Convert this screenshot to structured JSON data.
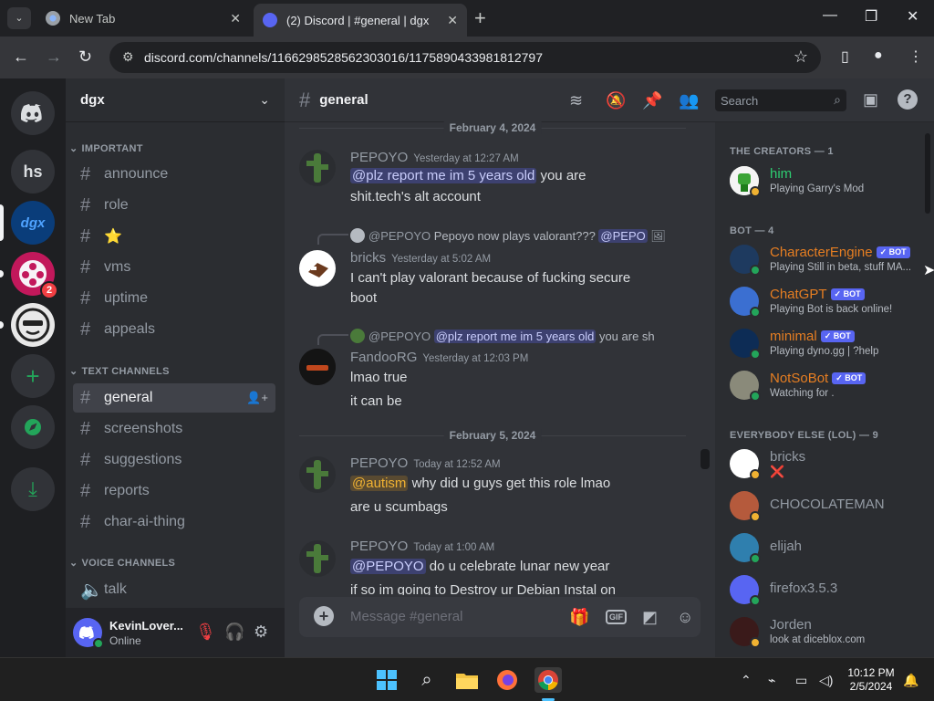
{
  "browser": {
    "tabs": [
      {
        "title": "New Tab"
      },
      {
        "title": "(2) Discord | #general | dgx"
      }
    ],
    "url": "discord.com/channels/1166298528562303016/1175890433981812797"
  },
  "servers": {
    "items": [
      {
        "name": "Home",
        "icon": "discord-logo-icon"
      },
      {
        "name": "hs",
        "label": "hs"
      },
      {
        "name": "dgx",
        "label": "dgx"
      },
      {
        "name": "film-server",
        "badge": "2"
      },
      {
        "name": "face-server"
      },
      {
        "name": "Add a Server",
        "icon": "plus-icon"
      },
      {
        "name": "Explore",
        "icon": "compass-icon"
      },
      {
        "name": "Download Apps",
        "icon": "download-icon"
      }
    ]
  },
  "guild": {
    "name": "dgx",
    "categories": [
      {
        "label": "IMPORTANT",
        "channels": [
          "announce",
          "role",
          "⭐",
          "vms",
          "uptime",
          "appeals"
        ]
      },
      {
        "label": "TEXT CHANNELS",
        "channels": [
          "general",
          "screenshots",
          "suggestions",
          "reports",
          "char-ai-thing"
        ]
      },
      {
        "label": "VOICE CHANNELS",
        "channels": [
          "talk"
        ]
      }
    ]
  },
  "user_panel": {
    "name": "KevinLover...",
    "status": "Online"
  },
  "channel": {
    "name": "general",
    "search_placeholder": "Search",
    "message_placeholder": "Message #general"
  },
  "dividers": [
    "February 4, 2024",
    "February 5, 2024"
  ],
  "messages": [
    {
      "author": "PEPOYO",
      "time": "Yesterday at 12:27 AM",
      "mention": "@plz report me im 5 years old",
      "text1": " you are",
      "text2": "shit.tech's alt account"
    },
    {
      "reply_author": "@PEPOYO",
      "reply_text": "Pepoyo now plays valorant???",
      "reply_mention": "@PEPO",
      "author": "bricks",
      "time": "Yesterday at 5:02 AM",
      "text1": "I can't play valorant because of fucking secure",
      "text2": "boot"
    },
    {
      "reply_author": "@PEPOYO",
      "reply_mention": "@plz report me im 5 years old",
      "reply_text": "you are sh",
      "author": "FandooRG",
      "time": "Yesterday at 12:03 PM",
      "text1": "lmao true",
      "text2": "it can be"
    },
    {
      "author": "PEPOYO",
      "time": "Today at 12:52 AM",
      "mention": "@autism",
      "text1": " why did u guys get this role lmao",
      "text2": "are u scumbags"
    },
    {
      "author": "PEPOYO",
      "time": "Today at 1:00 AM",
      "mention": "@PEPOYO",
      "text1": " do u celebrate lunar new year",
      "text2": "if so im going to Destroy ur Debian Instal on"
    }
  ],
  "members": {
    "groups": [
      {
        "label": "THE CREATORS — 1"
      },
      {
        "label": "BOT — 4"
      },
      {
        "label": "EVERYBODY ELSE (LOL) — 9"
      }
    ],
    "list": [
      {
        "name": "him",
        "activity": "Playing Garry's Mod"
      },
      {
        "name": "CharacterEngine",
        "bot": "✓ BOT",
        "activity": "Playing Still in beta, stuff MA..."
      },
      {
        "name": "ChatGPT",
        "bot": "✓ BOT",
        "activity": "Playing Bot is back online!"
      },
      {
        "name": "minimal",
        "bot": "✓ BOT",
        "activity": "Playing dyno.gg | ?help"
      },
      {
        "name": "NotSoBot",
        "bot": "✓ BOT",
        "activity": "Watching for ."
      },
      {
        "name": "bricks",
        "activity": "❌"
      },
      {
        "name": "CHOCOLATEMAN",
        "activity": ""
      },
      {
        "name": "elijah",
        "activity": ""
      },
      {
        "name": "firefox3.5.3",
        "activity": ""
      },
      {
        "name": "Jorden",
        "activity": "look at diceblox.com"
      }
    ]
  },
  "taskbar": {
    "time": "10:12 PM",
    "date": "2/5/2024"
  },
  "colors": {
    "blurple": "#5865f2",
    "online": "#23a55a",
    "idle": "#f0b232",
    "bot_orange": "#e67e22",
    "creator_green": "#2ecc71"
  }
}
